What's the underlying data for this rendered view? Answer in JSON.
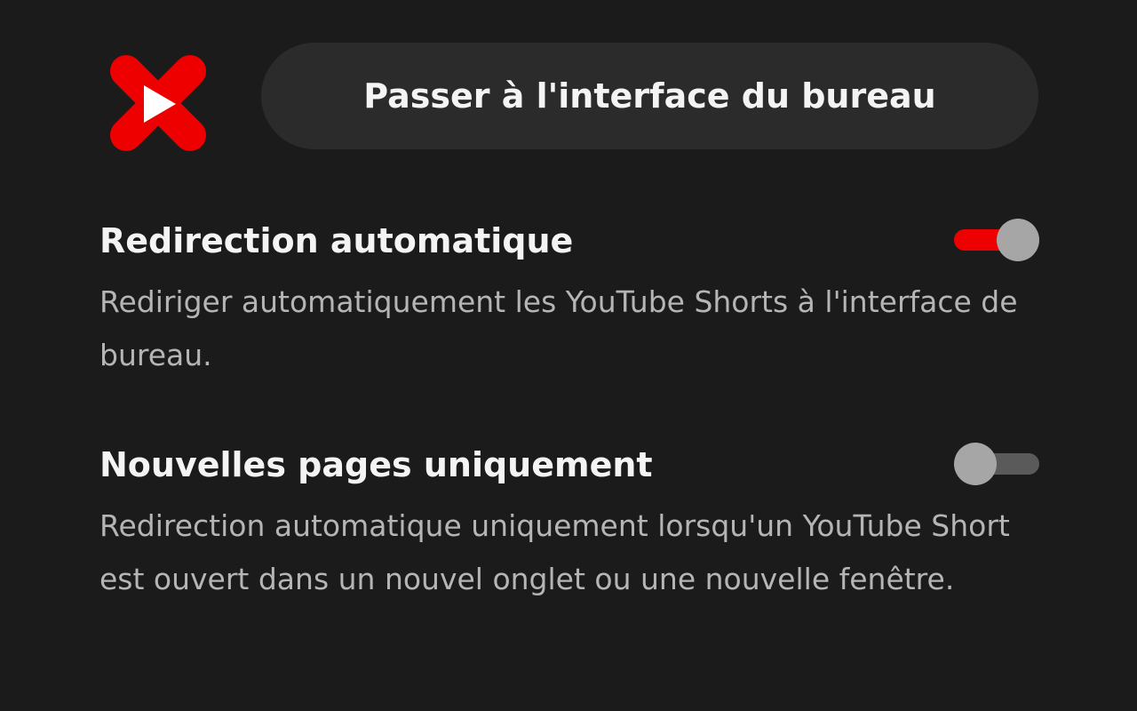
{
  "header": {
    "logo_icon": "shorts-redirect-logo-icon",
    "desktop_button_label": "Passer à l'interface du bureau"
  },
  "settings": [
    {
      "title": "Redirection automatique",
      "description": "Rediriger automatiquement les YouTube Shorts à l'interface de bureau.",
      "enabled": true
    },
    {
      "title": "Nouvelles pages uniquement",
      "description": "Redirection automatique uniquement lorsqu'un YouTube Short est ouvert dans un nouvel onglet ou une nouvelle fenêtre.",
      "enabled": false
    }
  ],
  "colors": {
    "background": "#1b1b1c",
    "accent": "#ee0000",
    "button_bg": "#2b2b2c",
    "toggle_off_track": "#5a5a5a",
    "knob": "#a6a6a6"
  }
}
